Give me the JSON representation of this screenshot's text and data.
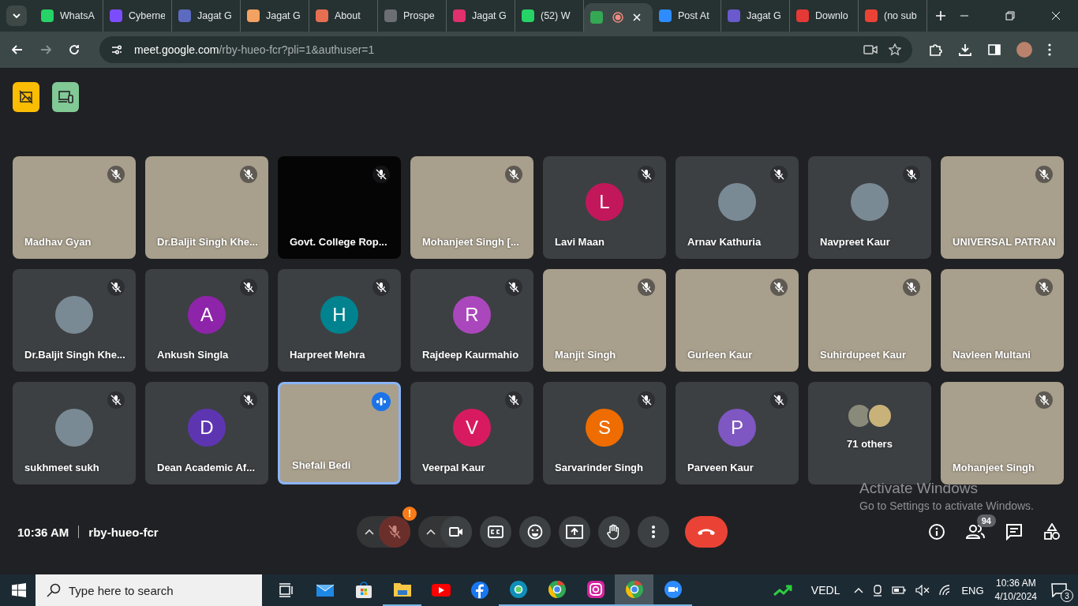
{
  "browser": {
    "tabs": [
      {
        "title": "WhatsA",
        "color": "#25d366",
        "selected": false
      },
      {
        "title": "Cyberne",
        "color": "#7c4dff",
        "selected": false
      },
      {
        "title": "Jagat G",
        "color": "#5c6bc0",
        "selected": false
      },
      {
        "title": "Jagat G",
        "color": "#f4a261",
        "selected": false
      },
      {
        "title": "About",
        "color": "#e76f51",
        "selected": false
      },
      {
        "title": "Prospe",
        "color": "#6b6f73",
        "selected": false
      },
      {
        "title": "Jagat G",
        "color": "#e1306c",
        "selected": false
      },
      {
        "title": "(52) W",
        "color": "#25d366",
        "selected": false
      },
      {
        "color": "#34a853",
        "selected": true
      },
      {
        "title": "Post At",
        "color": "#2d8cff",
        "selected": false
      },
      {
        "title": "Jagat G",
        "color": "#6a5acd",
        "selected": false
      },
      {
        "title": "Downlo",
        "color": "#e53935",
        "selected": false
      },
      {
        "title": "(no sub",
        "color": "#ea4335",
        "selected": false
      }
    ],
    "url_host": "meet.google.com",
    "url_path": "/rby-hueo-fcr?pli=1&authuser=1"
  },
  "participants": [
    {
      "name": "Madhav Gyan",
      "kind": "video",
      "muted": true,
      "speaking": false
    },
    {
      "name": "Dr.Baljit Singh Khe...",
      "kind": "video",
      "muted": true,
      "speaking": false
    },
    {
      "name": "Govt. College Rop...",
      "kind": "blank",
      "muted": true,
      "speaking": false
    },
    {
      "name": "Mohanjeet Singh [...",
      "kind": "video",
      "muted": true,
      "speaking": false
    },
    {
      "name": "Lavi Maan",
      "kind": "letter",
      "letter": "L",
      "color": "#c2185b",
      "muted": true,
      "speaking": false
    },
    {
      "name": "Arnav Kathuria",
      "kind": "photo",
      "muted": true,
      "speaking": false
    },
    {
      "name": "Navpreet Kaur",
      "kind": "photo",
      "muted": true,
      "speaking": false
    },
    {
      "name": "UNIVERSAL PATRAN",
      "kind": "video",
      "muted": true,
      "speaking": false
    },
    {
      "name": "Dr.Baljit Singh Khe...",
      "kind": "photo",
      "muted": true,
      "speaking": false
    },
    {
      "name": "Ankush Singla",
      "kind": "letter",
      "letter": "A",
      "color": "#8e24aa",
      "muted": true,
      "speaking": false
    },
    {
      "name": "Harpreet Mehra",
      "kind": "letter",
      "letter": "H",
      "color": "#00838f",
      "muted": true,
      "speaking": false
    },
    {
      "name": "Rajdeep Kaurmahio",
      "kind": "letter",
      "letter": "R",
      "color": "#ab47bc",
      "muted": true,
      "speaking": false
    },
    {
      "name": "Manjit Singh",
      "kind": "video",
      "muted": true,
      "speaking": false
    },
    {
      "name": "Gurleen Kaur",
      "kind": "video",
      "muted": true,
      "speaking": false
    },
    {
      "name": "Suhirdupeet Kaur",
      "kind": "video",
      "muted": true,
      "speaking": false
    },
    {
      "name": "Navleen Multani",
      "kind": "video",
      "muted": true,
      "speaking": false
    },
    {
      "name": "sukhmeet sukh",
      "kind": "photo",
      "muted": true,
      "speaking": false
    },
    {
      "name": "Dean Academic Af...",
      "kind": "letter",
      "letter": "D",
      "color": "#5e35b1",
      "muted": true,
      "speaking": false
    },
    {
      "name": "Shefali Bedi",
      "kind": "video",
      "muted": false,
      "speaking": true
    },
    {
      "name": "Veerpal Kaur",
      "kind": "letter",
      "letter": "V",
      "color": "#d81b60",
      "muted": true,
      "speaking": false
    },
    {
      "name": "Sarvarinder Singh",
      "kind": "letter",
      "letter": "S",
      "color": "#ef6c00",
      "muted": true,
      "speaking": false
    },
    {
      "name": "Parveen Kaur",
      "kind": "letter",
      "letter": "P",
      "color": "#7e57c2",
      "muted": true,
      "speaking": false
    },
    {
      "name": "71 others",
      "kind": "others",
      "muted": false,
      "speaking": false
    },
    {
      "name": "Mohanjeet Singh",
      "kind": "video",
      "muted": true,
      "speaking": false
    }
  ],
  "meeting": {
    "time": "10:36 AM",
    "code": "rby-hueo-fcr",
    "mic_warning": "!",
    "people_count": "94"
  },
  "activation": {
    "title": "Activate Windows",
    "subtitle": "Go to Settings to activate Windows."
  },
  "taskbar": {
    "search_placeholder": "Type here to search",
    "apps": [
      {
        "kind": "taskview",
        "running": false,
        "selected": false
      },
      {
        "kind": "mail",
        "running": false,
        "selected": false
      },
      {
        "kind": "store",
        "running": false,
        "selected": false
      },
      {
        "kind": "folder",
        "running": true,
        "selected": false
      },
      {
        "kind": "youtube",
        "running": false,
        "selected": false
      },
      {
        "kind": "facebook",
        "running": false,
        "selected": false
      },
      {
        "kind": "edge",
        "running": true,
        "selected": false
      },
      {
        "kind": "chrome",
        "running": true,
        "selected": false
      },
      {
        "kind": "instagram",
        "running": true,
        "selected": false
      },
      {
        "kind": "chrome",
        "running": true,
        "selected": true
      },
      {
        "kind": "zoom",
        "running": true,
        "selected": false
      }
    ],
    "stock": "VEDL",
    "language": "ENG",
    "time": "10:36 AM",
    "date": "4/10/2024",
    "notifications": "3"
  }
}
